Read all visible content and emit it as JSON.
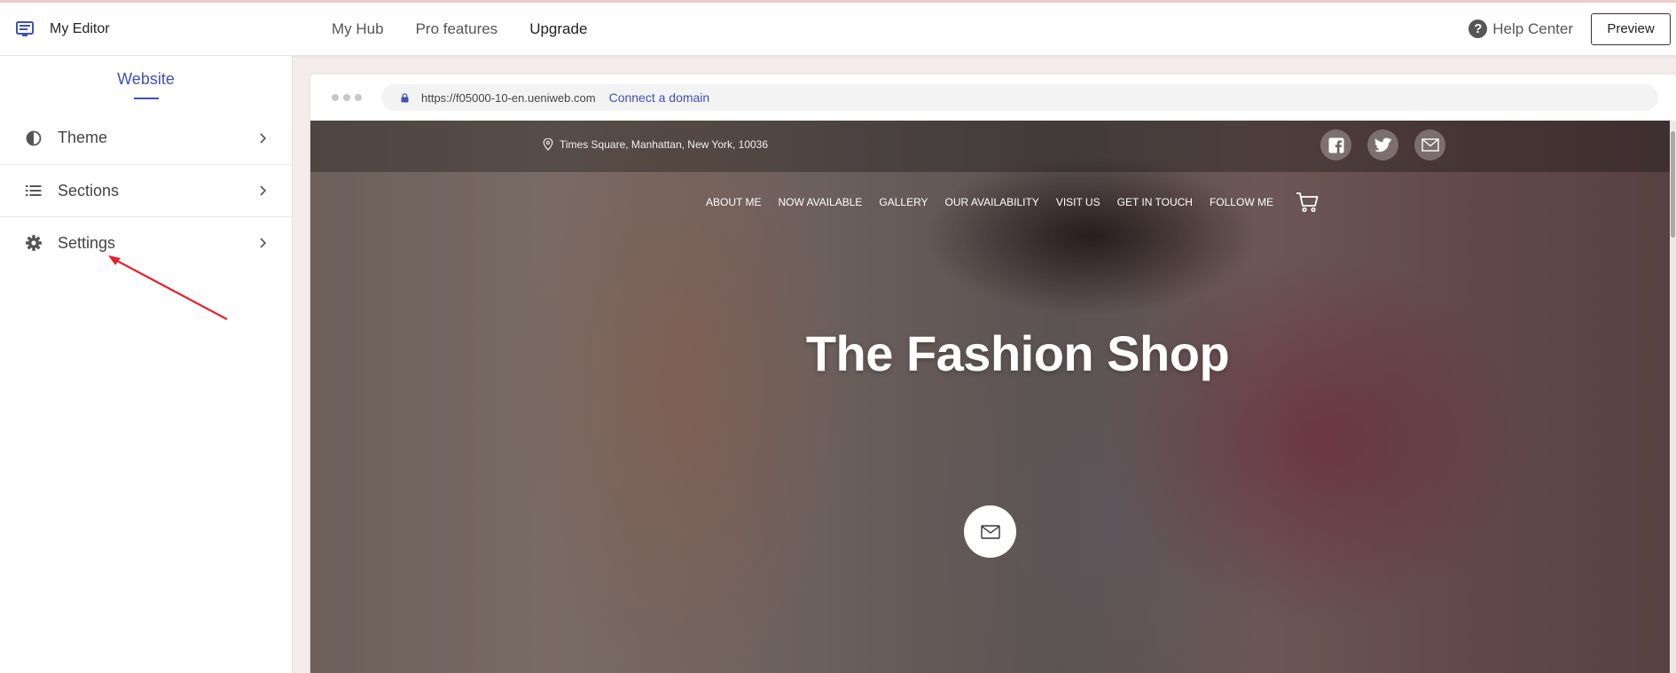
{
  "app": {
    "title": "My Editor"
  },
  "topnav": {
    "items": [
      "My Hub",
      "Pro features",
      "Upgrade"
    ],
    "help_center": "Help Center",
    "preview": "Preview"
  },
  "sidebar": {
    "tab": "Website",
    "items": [
      {
        "label": "Theme",
        "icon": "contrast-icon"
      },
      {
        "label": "Sections",
        "icon": "list-icon"
      },
      {
        "label": "Settings",
        "icon": "gear-icon"
      }
    ]
  },
  "browser": {
    "url": "https://f05000-10-en.ueniweb.com",
    "connect_domain": "Connect a domain"
  },
  "site": {
    "address": "Times Square, Manhattan, New York, 10036",
    "socials": [
      "facebook-icon",
      "twitter-icon",
      "email-icon"
    ],
    "nav": [
      "ABOUT ME",
      "NOW AVAILABLE",
      "GALLERY",
      "OUR AVAILABILITY",
      "VISIT US",
      "GET IN TOUCH",
      "FOLLOW ME"
    ],
    "hero_title": "The Fashion Shop"
  },
  "colors": {
    "accent": "#3f51b5",
    "annotation_arrow": "#e8202a"
  }
}
